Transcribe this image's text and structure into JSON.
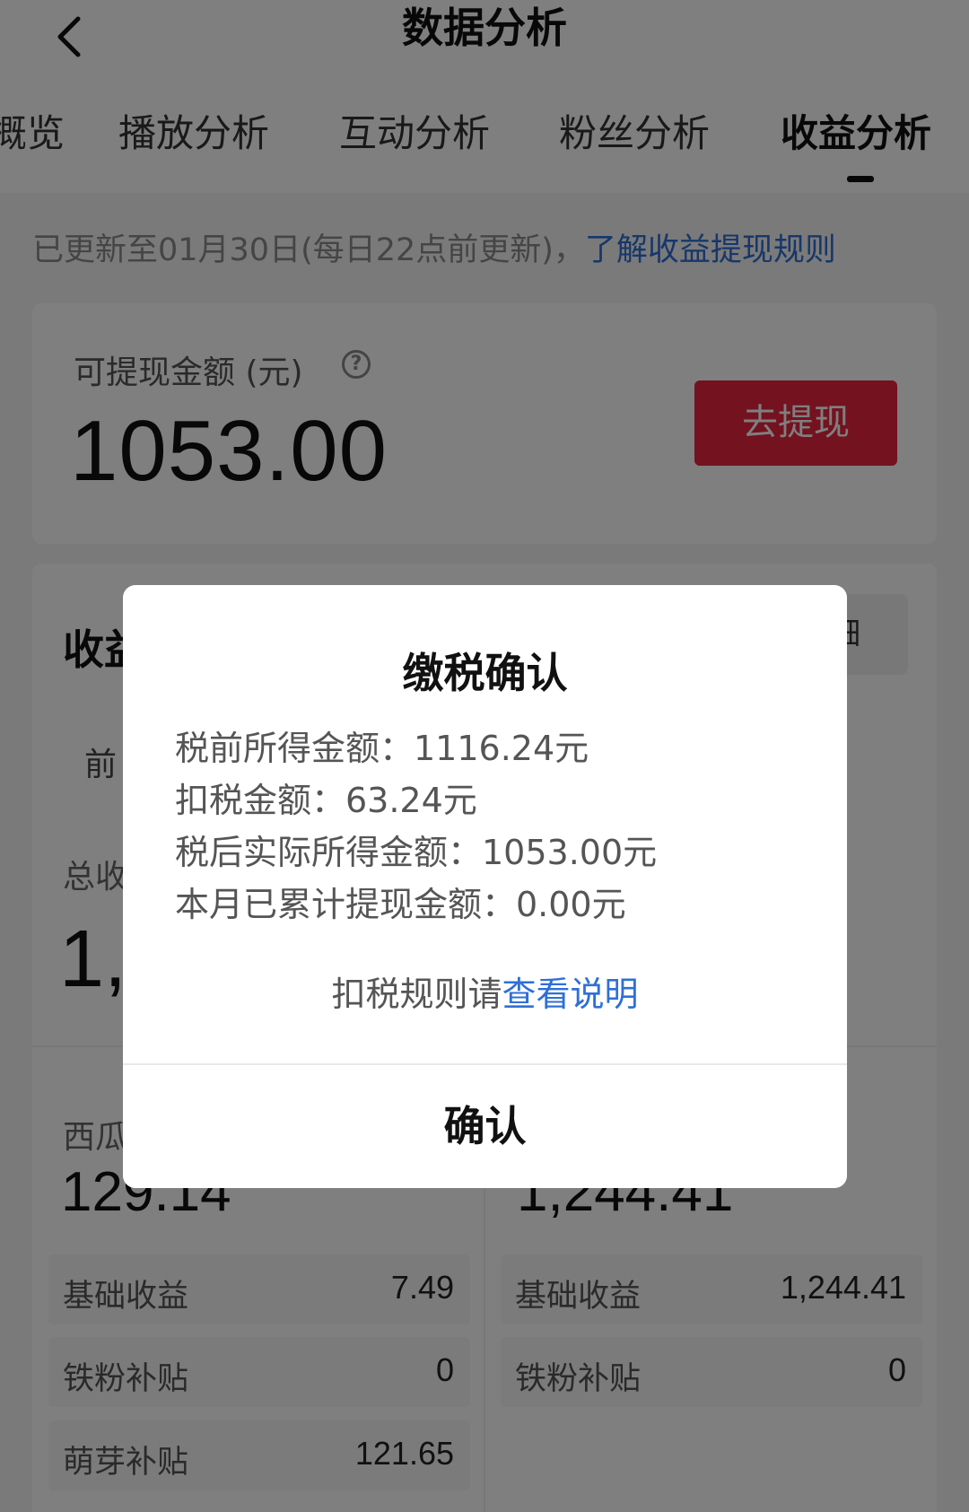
{
  "header": {
    "title": "数据分析",
    "back_icon": "chevron-left-icon"
  },
  "tabs": [
    {
      "label": "概览",
      "active": false
    },
    {
      "label": "播放分析",
      "active": false
    },
    {
      "label": "互动分析",
      "active": false
    },
    {
      "label": "粉丝分析",
      "active": false
    },
    {
      "label": "收益分析",
      "active": true
    }
  ],
  "notice": {
    "text": "已更新至01月30日(每日22点前更新)，",
    "link": "了解收益提现规则"
  },
  "balance": {
    "label": "可提现金额 (元)",
    "help_icon": "question-circle-icon",
    "amount": "1053.00",
    "withdraw_label": "去提现"
  },
  "income": {
    "title": "收益",
    "detail_label": "细",
    "range_tab": "前",
    "total_label": "总收",
    "total_value": "1,",
    "left_col": {
      "title": "西瓜",
      "value": "129.14",
      "rows": [
        {
          "label": "基础收益",
          "value": "7.49"
        },
        {
          "label": "铁粉补贴",
          "value": "0"
        },
        {
          "label": "萌芽补贴",
          "value": "121.65"
        }
      ]
    },
    "right_col": {
      "value": "1,244.41",
      "rows": [
        {
          "label": "基础收益",
          "value": "1,244.41"
        },
        {
          "label": "铁粉补贴",
          "value": "0"
        }
      ]
    }
  },
  "dialog": {
    "title": "缴税确认",
    "lines": [
      "税前所得金额：1116.24元",
      "扣税金额：63.24元",
      "税后实际所得金额：1053.00元",
      "本月已累计提现金额：0.00元"
    ],
    "note_prefix": "扣税规则请",
    "note_link": "查看说明",
    "confirm_label": "确认"
  },
  "colors": {
    "accent_red": "#e8243f",
    "link_blue": "#2f6fd6"
  }
}
